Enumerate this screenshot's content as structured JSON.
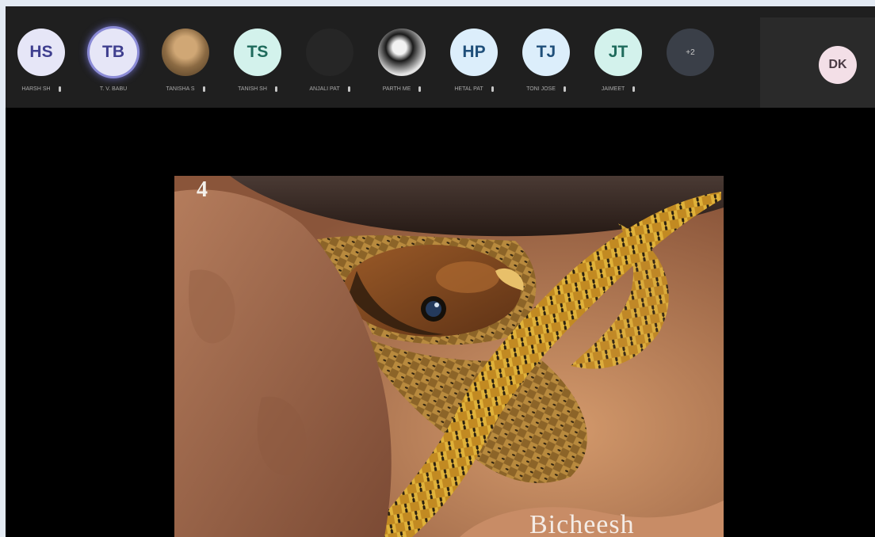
{
  "participants": [
    {
      "initials": "HS",
      "name": "HARSH SH",
      "avatar_color": "#e6e6f7",
      "text_color": "#3f3f8f"
    },
    {
      "initials": "TB",
      "name": "T. V. Babu",
      "avatar_color": "#e6e6f7",
      "text_color": "#3f3f8f",
      "speaking": true
    },
    {
      "initials": "",
      "name": "TANISHA S",
      "avatar": "photo"
    },
    {
      "initials": "TS",
      "name": "TANISH SH",
      "avatar_color": "#d3f2ec",
      "text_color": "#1f6b5c"
    },
    {
      "initials": "",
      "name": "ANJALI PAT",
      "avatar": "blank"
    },
    {
      "initials": "",
      "name": "PARTH ME",
      "avatar": "photo"
    },
    {
      "initials": "HP",
      "name": "HETAL PAT",
      "avatar_color": "#dceefb",
      "text_color": "#1f4f7a"
    },
    {
      "initials": "TJ",
      "name": "TONI JOSE",
      "avatar_color": "#dceefb",
      "text_color": "#1f4f7a"
    },
    {
      "initials": "JT",
      "name": "JAIMEET",
      "avatar_color": "#d3f2ec",
      "text_color": "#1f6b5c"
    }
  ],
  "more_participants": "+2",
  "self": {
    "initials": "DK"
  },
  "presentation": {
    "slide_number": "4",
    "credit": "Bicheesh"
  }
}
